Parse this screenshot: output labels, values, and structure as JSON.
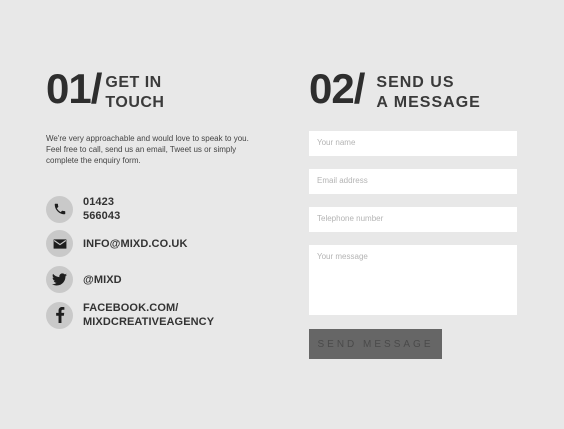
{
  "left": {
    "number": "01/",
    "title_line1": "GET IN",
    "title_line2": "TOUCH",
    "intro": "We're very approachable and would love to speak to you. Feel free to call, send us an email, Tweet us or simply complete the enquiry form.",
    "contacts": [
      {
        "icon": "phone-icon",
        "label": "01423 566043"
      },
      {
        "icon": "mail-icon",
        "label": "INFO@MIXD.CO.UK"
      },
      {
        "icon": "twitter-icon",
        "label": "@MIXD"
      },
      {
        "icon": "facebook-icon",
        "line1": "FACEBOOK.COM/",
        "line2": "MIXDCREATIVEAGENCY"
      }
    ]
  },
  "right": {
    "number": "02/",
    "title_line1": "SEND US",
    "title_line2": "A MESSAGE",
    "form": {
      "name_placeholder": "Your name",
      "email_placeholder": "Email address",
      "phone_placeholder": "Telephone number",
      "message_placeholder": "Your message",
      "send_label": "SEND MESSAGE"
    }
  },
  "colors": {
    "background": "#e8e8e8",
    "icon_circle": "#c9c9c9",
    "button": "#666666",
    "field": "#ffffff"
  }
}
